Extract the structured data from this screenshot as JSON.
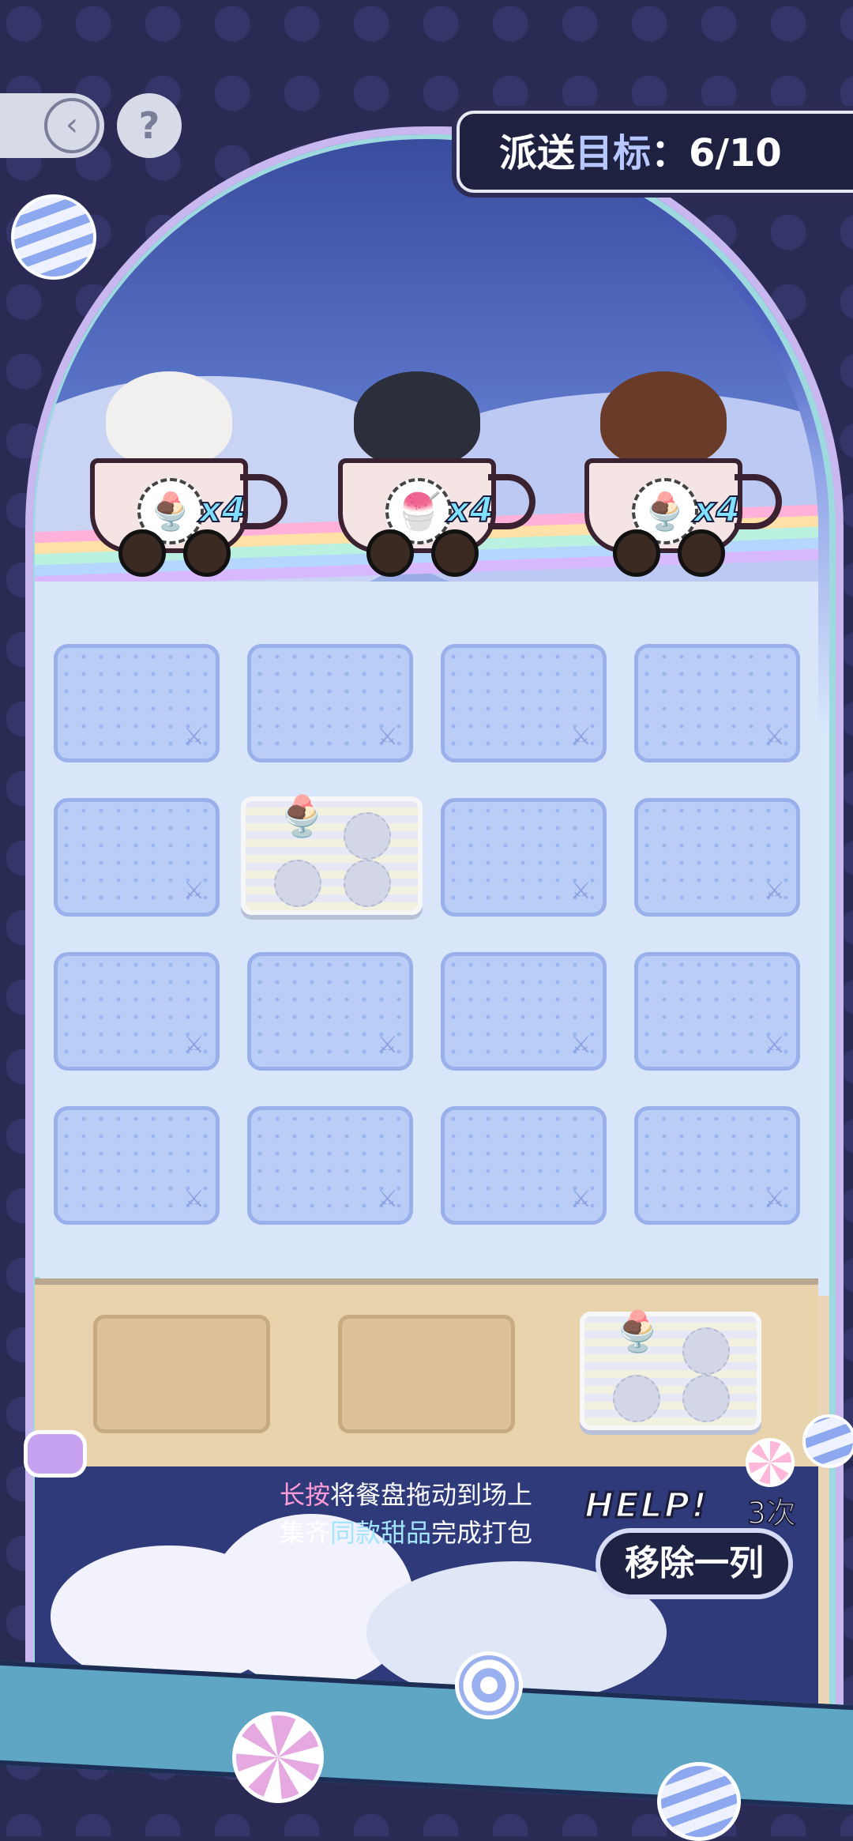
{
  "header": {
    "goal_label": "派送",
    "goal_label_hl": "目标",
    "goal_sep": "：",
    "goal_value": "6/10",
    "back_glyph": "‹",
    "help_glyph": "?"
  },
  "carts": [
    {
      "character": "white-haired",
      "dessert_icon": "orange-sundae",
      "dessert_glyph": "🍨",
      "count": "x4"
    },
    {
      "character": "black-haired",
      "dessert_icon": "blue-sundae",
      "dessert_glyph": "🍧",
      "count": "x4"
    },
    {
      "character": "brown-haired",
      "dessert_icon": "white-sundae",
      "dessert_glyph": "🍨",
      "count": "x4"
    }
  ],
  "board": {
    "rows": 4,
    "cols": 4,
    "tray_cell": {
      "row": 2,
      "col": 2,
      "dessert_glyph": "🍨"
    }
  },
  "counter": {
    "spare_slots": 2,
    "tray_dessert_glyph": "🍨"
  },
  "hint": {
    "line1_hl": "长按",
    "line1_rest": "将餐盘拖动到场上",
    "line2_pre": "集齐",
    "line2_hl": "同款甜品",
    "line2_rest": "完成打包"
  },
  "powerup": {
    "title": "HELP!",
    "count": "3次",
    "label": "移除一列"
  },
  "colors": {
    "background": "#2a2b54",
    "goal_highlight": "#b7c7ff",
    "hint_pink": "#ff9bd6",
    "hint_cyan": "#a3e4ff"
  }
}
